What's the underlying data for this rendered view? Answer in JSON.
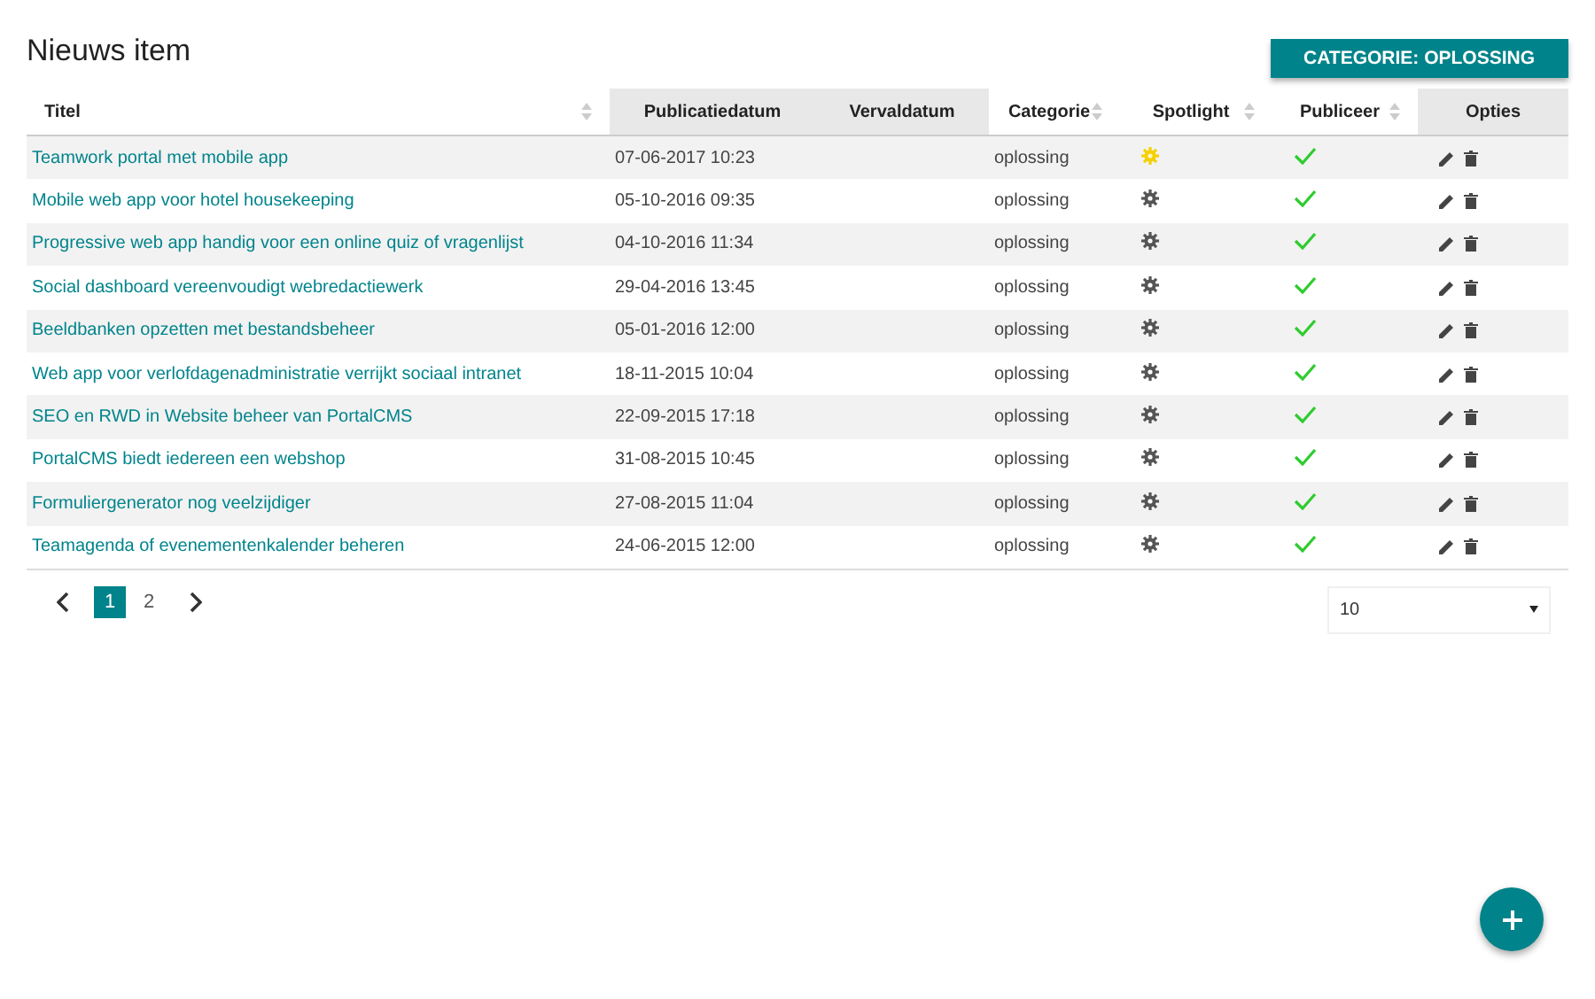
{
  "page": {
    "title": "Nieuws item",
    "category_button": "CATEGORIE: OPLOSSING"
  },
  "table": {
    "columns": [
      {
        "label": "Titel",
        "sortable": true
      },
      {
        "label": "Publicatiedatum",
        "sortable": false
      },
      {
        "label": "Vervaldatum",
        "sortable": false
      },
      {
        "label": "Categorie",
        "sortable": true
      },
      {
        "label": "Spotlight",
        "sortable": true
      },
      {
        "label": "Publiceer",
        "sortable": true
      },
      {
        "label": "Opties",
        "sortable": false
      }
    ],
    "rows": [
      {
        "title": "Teamwork portal met mobile app",
        "date": "07-06-2017 10:23",
        "category": "oplossing",
        "spotlight": true,
        "published": true
      },
      {
        "title": "Mobile web app voor hotel housekeeping",
        "date": "05-10-2016 09:35",
        "category": "oplossing",
        "spotlight": false,
        "published": true
      },
      {
        "title": "Progressive web app handig voor een online quiz of vragenlijst",
        "date": "04-10-2016 11:34",
        "category": "oplossing",
        "spotlight": false,
        "published": true
      },
      {
        "title": "Social dashboard vereenvoudigt webredactiewerk",
        "date": "29-04-2016 13:45",
        "category": "oplossing",
        "spotlight": false,
        "published": true
      },
      {
        "title": "Beeldbanken opzetten met bestandsbeheer",
        "date": "05-01-2016 12:00",
        "category": "oplossing",
        "spotlight": false,
        "published": true
      },
      {
        "title": "Web app voor verlofdagenadministratie verrijkt sociaal intranet",
        "date": "18-11-2015 10:04",
        "category": "oplossing",
        "spotlight": false,
        "published": true
      },
      {
        "title": "SEO en RWD in Website beheer van PortalCMS",
        "date": "22-09-2015 17:18",
        "category": "oplossing",
        "spotlight": false,
        "published": true
      },
      {
        "title": "PortalCMS biedt iedereen een webshop",
        "date": "31-08-2015 10:45",
        "category": "oplossing",
        "spotlight": false,
        "published": true
      },
      {
        "title": "Formuliergenerator nog veelzijdiger",
        "date": "27-08-2015 11:04",
        "category": "oplossing",
        "spotlight": false,
        "published": true
      },
      {
        "title": "Teamagenda of evenementenkalender beheren",
        "date": "24-06-2015 12:00",
        "category": "oplossing",
        "spotlight": false,
        "published": true
      }
    ]
  },
  "pagination": {
    "pages": [
      {
        "label": "1",
        "selected": true
      },
      {
        "label": "2",
        "selected": false
      }
    ],
    "page_size": "10"
  }
}
